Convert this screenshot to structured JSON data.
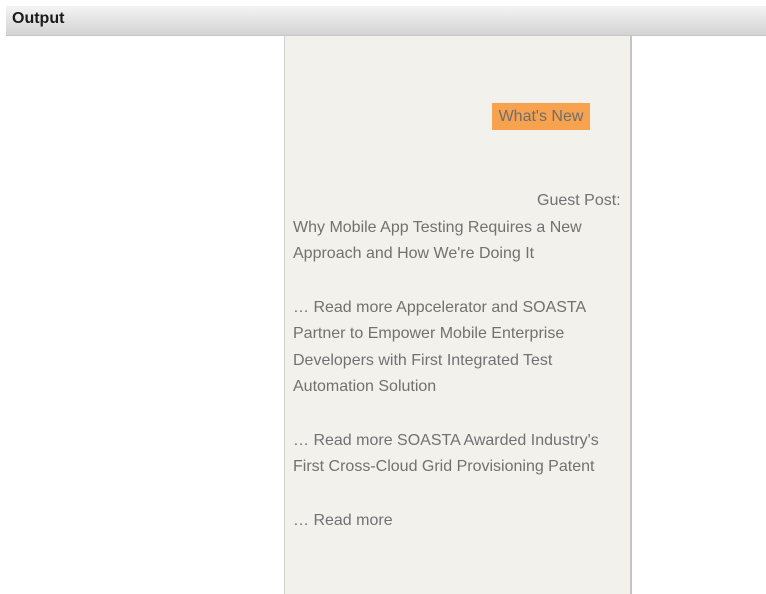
{
  "panel": {
    "title": "Output"
  },
  "content": {
    "whats_new": "What's New",
    "items": [
      {
        "lead": "Guest",
        "title": "Post: Why Mobile App Testing Requires a New Approach and How We're Doing It"
      },
      {
        "read_more": "… Read more",
        "title": "Appcelerator and SOASTA Partner to Empower Mobile Enterprise Developers with First Integrated Test Automation Solution"
      },
      {
        "read_more": "… Read more",
        "title": "SOASTA Awarded Industry's First Cross-Cloud Grid Provisioning Patent"
      },
      {
        "read_more": "… Read more"
      }
    ]
  },
  "colors": {
    "highlight": "#f7a24e",
    "frame_background": "#f2f1ec",
    "text": "#717171"
  }
}
